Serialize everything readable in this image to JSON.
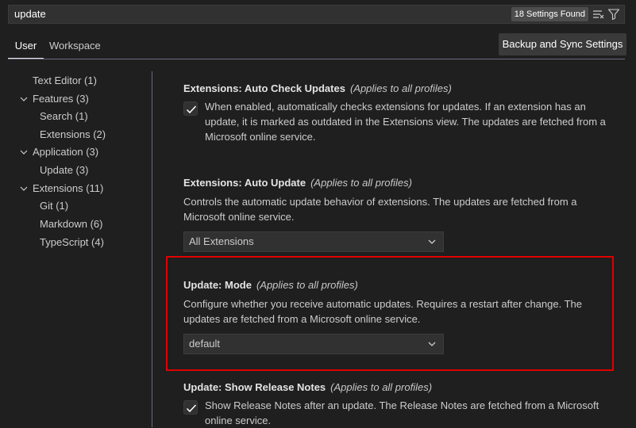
{
  "search": {
    "query": "update",
    "results_badge": "18 Settings Found",
    "clear_icon": "clear-filter-icon",
    "filter_icon": "filter-icon"
  },
  "tabs": {
    "user": "User",
    "workspace": "Workspace",
    "sync_button": "Backup and Sync Settings"
  },
  "toc": {
    "items": [
      {
        "label": "Text Editor (1)",
        "expanded": false
      },
      {
        "label": "Features (3)",
        "expanded": true
      },
      {
        "label": "Search (1)"
      },
      {
        "label": "Extensions (2)"
      },
      {
        "label": "Application (3)",
        "expanded": true
      },
      {
        "label": "Update (3)"
      },
      {
        "label": "Extensions (11)",
        "expanded": true
      },
      {
        "label": "Git (1)"
      },
      {
        "label": "Markdown (6)"
      },
      {
        "label": "TypeScript (4)"
      }
    ]
  },
  "settings": {
    "auto_check_updates": {
      "title": "Extensions: Auto Check Updates",
      "scope": "(Applies to all profiles)",
      "checked": true,
      "description": "When enabled, automatically checks extensions for updates. If an extension has an update, it is marked as outdated in the Extensions view. The updates are fetched from a Microsoft online service."
    },
    "auto_update": {
      "title": "Extensions: Auto Update",
      "scope": "(Applies to all profiles)",
      "description": "Controls the automatic update behavior of extensions. The updates are fetched from a Microsoft online service.",
      "value": "All Extensions"
    },
    "update_mode": {
      "title": "Update: Mode",
      "scope": "(Applies to all profiles)",
      "description": "Configure whether you receive automatic updates. Requires a restart after change. The updates are fetched from a Microsoft online service.",
      "value": "default"
    },
    "show_release_notes": {
      "title": "Update: Show Release Notes",
      "scope": "(Applies to all profiles)",
      "checked": true,
      "description": "Show Release Notes after an update. The Release Notes are fetched from a Microsoft online service."
    }
  },
  "colors": {
    "highlight": "#e00000",
    "background": "#1f1f1f"
  }
}
